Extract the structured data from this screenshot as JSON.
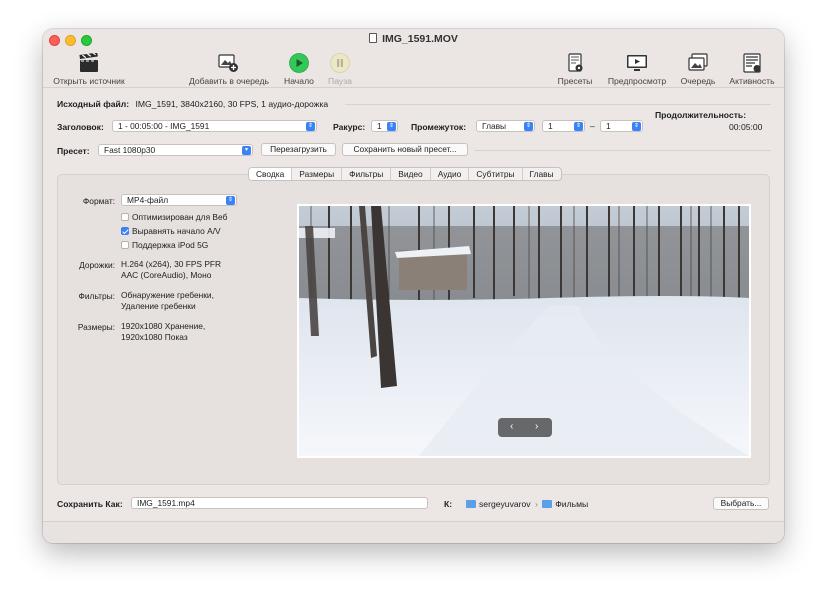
{
  "window": {
    "title": "IMG_1591.MOV"
  },
  "toolbar": {
    "open_source": "Открыть источник",
    "add_to_queue": "Добавить в очередь",
    "start": "Начало",
    "pause": "Пауза",
    "presets": "Пресеты",
    "preview": "Предпросмотр",
    "queue": "Очередь",
    "activity": "Активность"
  },
  "source": {
    "label": "Исходный файл:",
    "value": "IMG_1591, 3840x2160, 30 FPS, 1 аудио-дорожка"
  },
  "title_row": {
    "label": "Заголовок:",
    "title_value": "1 - 00:05:00 - IMG_1591",
    "angle_label": "Ракурс:",
    "angle_value": "1",
    "range_label": "Промежуток:",
    "range_type": "Главы",
    "range_start": "1",
    "range_dash": "–",
    "range_end": "1",
    "duration_label": "Продолжительность:",
    "duration_value": "00:05:00"
  },
  "preset_row": {
    "label": "Пресет:",
    "value": "Fast 1080p30",
    "reload": "Перезагрузить",
    "save_new": "Сохранить новый пресет..."
  },
  "tabs": [
    "Сводка",
    "Размеры",
    "Фильтры",
    "Видео",
    "Аудио",
    "Субтитры",
    "Главы"
  ],
  "summary": {
    "format_label": "Формат:",
    "format_value": "MP4-файл",
    "opt_web": "Оптимизирован для Веб",
    "align_av": "Выравнять начало A/V",
    "ipod": "Поддержка iPod 5G",
    "tracks_label": "Дорожки:",
    "tracks_1": "H.264 (x264), 30 FPS PFR",
    "tracks_2": "AAC (CoreAudio), Моно",
    "filters_label": "Фильтры:",
    "filters_1": "Обнаружение гребенки,",
    "filters_2": "Удаление гребенки",
    "sizes_label": "Размеры:",
    "sizes_1": "1920x1080 Хранение,",
    "sizes_2": "1920x1080 Показ",
    "checked": {
      "opt_web": false,
      "align_av": true,
      "ipod": false
    }
  },
  "preview": {
    "prev": "‹",
    "next": "›"
  },
  "save": {
    "label": "Сохранить Как:",
    "filename": "IMG_1591.mp4",
    "to_label": "К:",
    "path_1": "sergeyuvarov",
    "path_sep": "›",
    "path_2": "Фильмы",
    "choose": "Выбрать..."
  },
  "colors": {
    "accent": "#3b82f6",
    "start_green": "#34c759"
  }
}
